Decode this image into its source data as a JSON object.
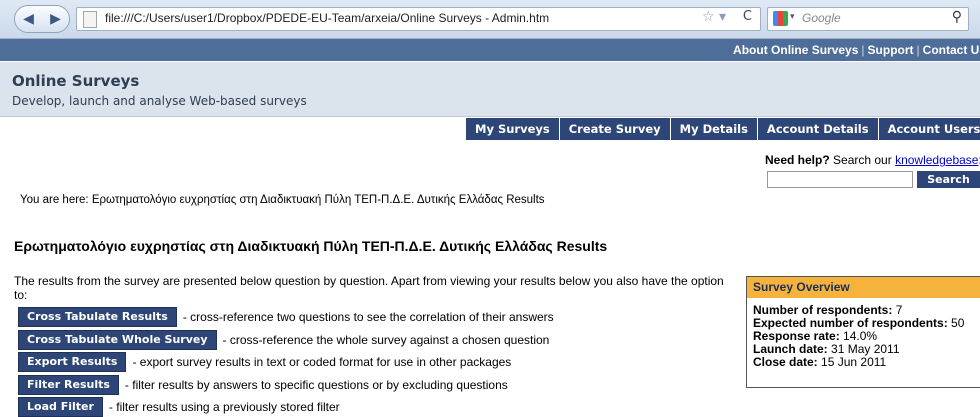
{
  "browser": {
    "url": "file:///C:/Users/user1/Dropbox/PDEDE-EU-Team/arxeia/Online Surveys - Admin.htm",
    "search_engine": "Google",
    "back_glyph": "◀",
    "forward_glyph": "▶",
    "star_glyph": "☆ ▾",
    "reload_glyph": "C",
    "search_glyph": "⚲"
  },
  "toplinks": {
    "about": "About Online Surveys",
    "support": "Support",
    "contact": "Contact Us",
    "sep": "|"
  },
  "header": {
    "title": "Online Surveys",
    "tagline": "Develop, launch and analyse Web-based surveys"
  },
  "tabs": [
    "My Surveys",
    "Create Survey",
    "My Details",
    "Account Details",
    "Account Users"
  ],
  "help": {
    "prefix": "Need help?",
    "text": " Search our ",
    "link": "knowledgebase",
    "suffix": ":",
    "search_label": "Search"
  },
  "breadcrumb": "You are here: Ερωτηματολόγιο ευχρηστίας στη Διαδικτυακή Πύλη ΤΕΠ-Π.Δ.Ε. Δυτικής Ελλάδας Results",
  "survey_title": "Ερωτηματολόγιο ευχρηστίας στη Διαδικτυακή Πύλη ΤΕΠ-Π.Δ.Ε. Δυτικής Ελλάδας Results",
  "intro": "The results from the survey are presented below question by question. Apart from viewing your results below you also have the option to:",
  "actions": [
    {
      "label": "Cross Tabulate Results",
      "desc": "- cross-reference two questions to see the correlation of their answers"
    },
    {
      "label": "Cross Tabulate Whole Survey",
      "desc": "- cross-reference the whole survey against a chosen question"
    },
    {
      "label": "Export Results",
      "desc": "- export survey results in text or coded format for use in other packages"
    },
    {
      "label": "Filter Results",
      "desc": "- filter results by answers to specific questions or by excluding questions"
    },
    {
      "label": "Load Filter",
      "desc": "- filter results using a previously stored filter"
    }
  ],
  "overview": {
    "title": "Survey Overview",
    "rows": [
      {
        "label": "Number of respondents:",
        "value": "7"
      },
      {
        "label": "Expected number of respondents:",
        "value": "50"
      },
      {
        "label": "Response rate:",
        "value": "14.0%"
      },
      {
        "label": "Launch date:",
        "value": "31 May 2011"
      },
      {
        "label": "Close date:",
        "value": "15 Jun 2011"
      }
    ]
  },
  "colors": {
    "nav_dark": "#2e4677",
    "top_bar": "#4f6d99",
    "header_bg": "#dbe3ec",
    "overview_head": "#f5b33d",
    "link": "#0000cc"
  }
}
